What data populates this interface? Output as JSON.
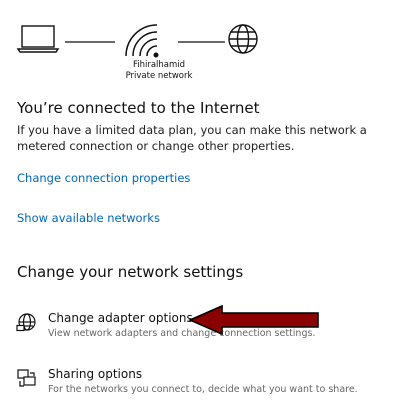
{
  "status": {
    "network_name": "Fihiralhamid",
    "network_type": "Private network",
    "icons": [
      "laptop-icon",
      "wifi-icon",
      "globe-icon"
    ]
  },
  "connection": {
    "heading": "You’re connected to the Internet",
    "description": "If you have a limited data plan, you can make this network a metered connection or change other properties.",
    "change_properties_link": "Change connection properties",
    "show_networks_link": "Show available networks"
  },
  "network_settings": {
    "heading": "Change your network settings",
    "options": [
      {
        "title": "Change adapter options",
        "description": "View network adapters and change connection settings.",
        "icon": "network-adapter-icon"
      },
      {
        "title": "Sharing options",
        "description": "For the networks you connect to, decide what you want to share.",
        "icon": "sharing-icon"
      }
    ]
  },
  "colors": {
    "link": "#0067b8",
    "text": "#111111",
    "secondary_text": "#666666",
    "annotation_arrow": "#8b0000"
  }
}
